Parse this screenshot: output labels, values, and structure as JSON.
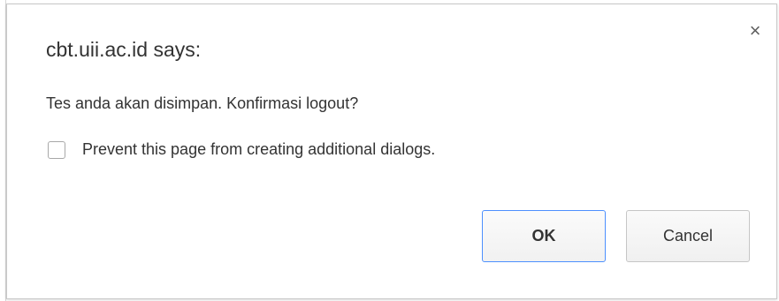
{
  "dialog": {
    "title": "cbt.uii.ac.id says:",
    "close_glyph": "×",
    "close_icon": "close-icon",
    "message": "Tes anda akan disimpan. Konfirmasi logout?",
    "checkbox": {
      "label": "Prevent this page from creating additional dialogs.",
      "checked": false
    },
    "buttons": {
      "ok_label": "OK",
      "cancel_label": "Cancel"
    },
    "colors": {
      "focus_border": "#4d90fe",
      "text": "#333333"
    }
  }
}
